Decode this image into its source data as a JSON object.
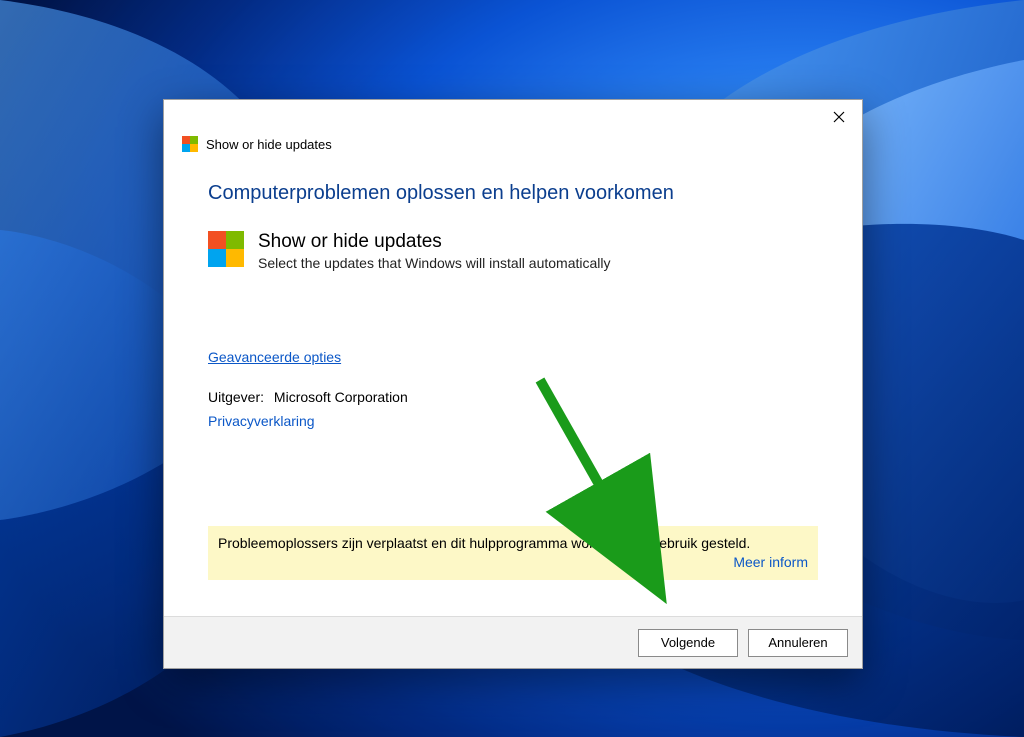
{
  "window": {
    "title": "Show or hide updates"
  },
  "headline": "Computerproblemen oplossen en helpen voorkomen",
  "section": {
    "title": "Show or hide updates",
    "subtitle": "Select the updates that Windows will install automatically"
  },
  "links": {
    "advanced": "Geavanceerde opties",
    "privacy": "Privacyverklaring"
  },
  "publisher": {
    "label": "Uitgever:",
    "value": "Microsoft Corporation"
  },
  "notice": {
    "text": "Probleemoplossers zijn verplaatst en dit hulpprogramma wordt buiten gebruik gesteld.",
    "more": "Meer inform"
  },
  "buttons": {
    "next": "Volgende",
    "cancel": "Annuleren"
  }
}
